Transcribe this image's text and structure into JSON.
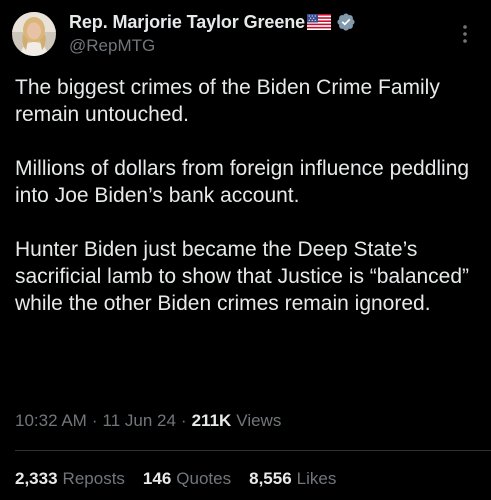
{
  "author": {
    "display_name": "Rep. Marjorie Taylor Greene",
    "handle": "@RepMTG",
    "flag_icon": "us-flag-icon",
    "verified_icon": "verified-badge-icon",
    "badge_color": "#829aab"
  },
  "tweet": {
    "paragraphs": [
      "The biggest crimes of the Biden Crime Family remain untouched.",
      "Millions of dollars from foreign influence peddling into Joe Biden’s bank account.",
      "Hunter Biden just became the Deep State’s sacrificial lamb to show that Justice is “balanced” while the other Biden crimes remain ignored."
    ]
  },
  "meta": {
    "time": "10:32 AM",
    "separator": "·",
    "date": "11 Jun 24",
    "views_count": "211K",
    "views_label": "Views"
  },
  "stats": {
    "reposts_count": "2,333",
    "reposts_label": "Reposts",
    "quotes_count": "146",
    "quotes_label": "Quotes",
    "likes_count": "8,556",
    "likes_label": "Likes"
  },
  "colors": {
    "background": "#000000",
    "text_primary": "#e7e9ea",
    "text_secondary": "#71767b",
    "divider": "#2f3336"
  }
}
